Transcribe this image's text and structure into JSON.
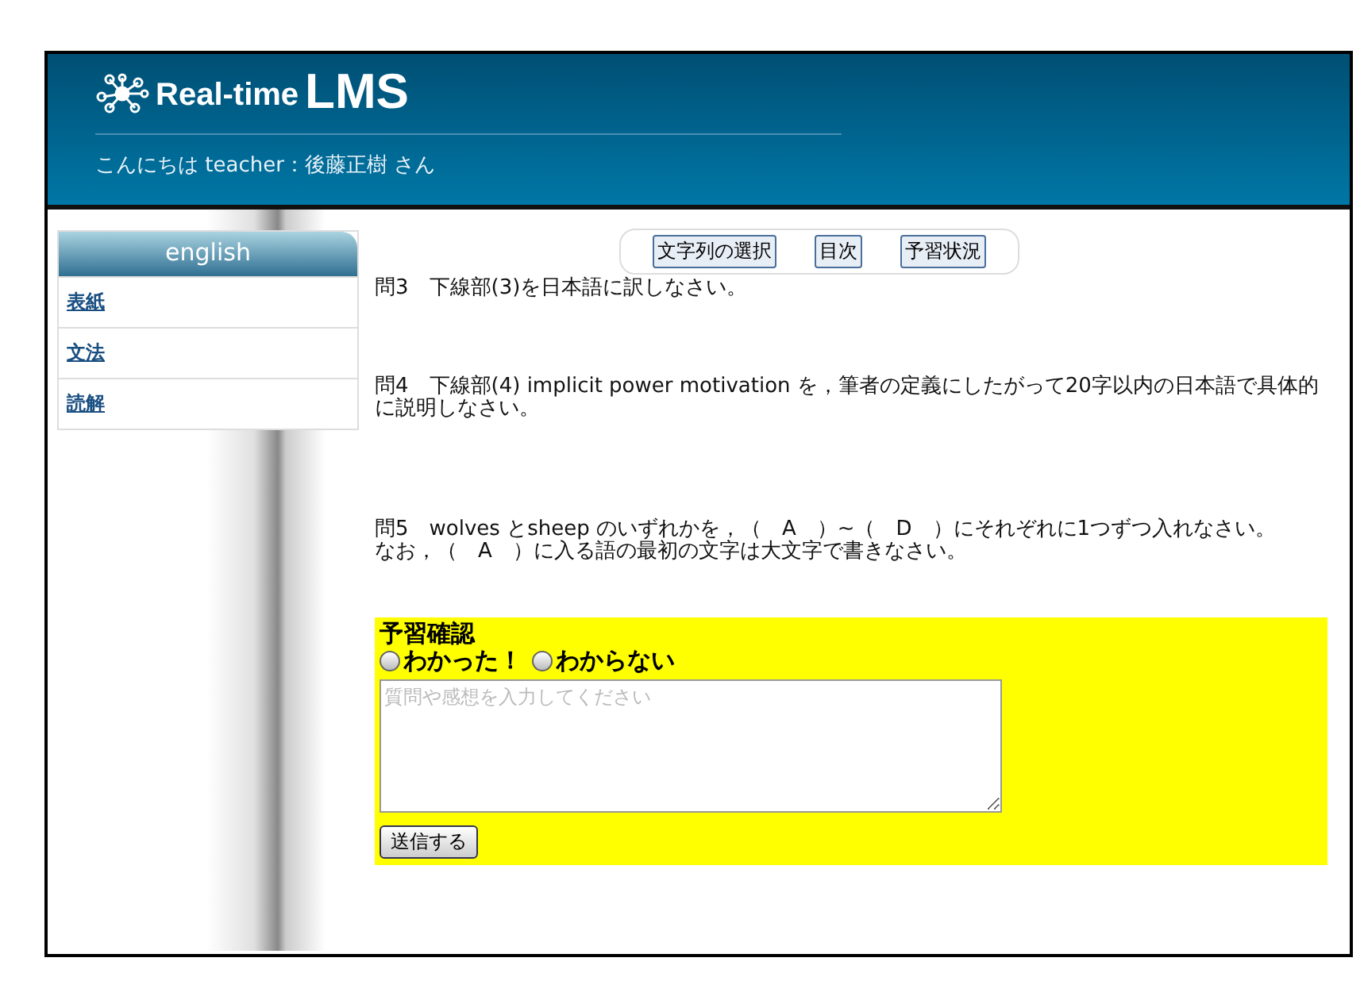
{
  "header": {
    "logo_text": "Real-time",
    "logo_big": "LMS",
    "greeting": "こんにちは teacher：後藤正樹 さん"
  },
  "sidebar": {
    "title": "english",
    "items": [
      {
        "label": "表紙"
      },
      {
        "label": "文法"
      },
      {
        "label": "読解"
      }
    ]
  },
  "toolbar": {
    "buttons": [
      "文字列の選択",
      "目次",
      "予習状況"
    ]
  },
  "questions": [
    {
      "lines": [
        "問3　下線部(3)を日本語に訳しなさい。"
      ]
    },
    {
      "lines": [
        "問4　下線部(4) implicit power motivation を，筆者の定義にしたがって20字以内の日本語で具体的に説明しなさい。"
      ]
    },
    {
      "lines": [
        "問5　wolves とsheep のいずれかを，（　A　）~（　D　）にそれぞれに1つずつ入れなさい。",
        "なお，（　A　）に入る語の最初の文字は大文字で書きなさい。"
      ]
    }
  ],
  "review": {
    "title": "予習確認",
    "options": [
      {
        "label": "わかった！",
        "selected": false
      },
      {
        "label": "わからない",
        "selected": false
      }
    ],
    "placeholder": "質問や感想を入力してください",
    "submit": "送信する"
  }
}
